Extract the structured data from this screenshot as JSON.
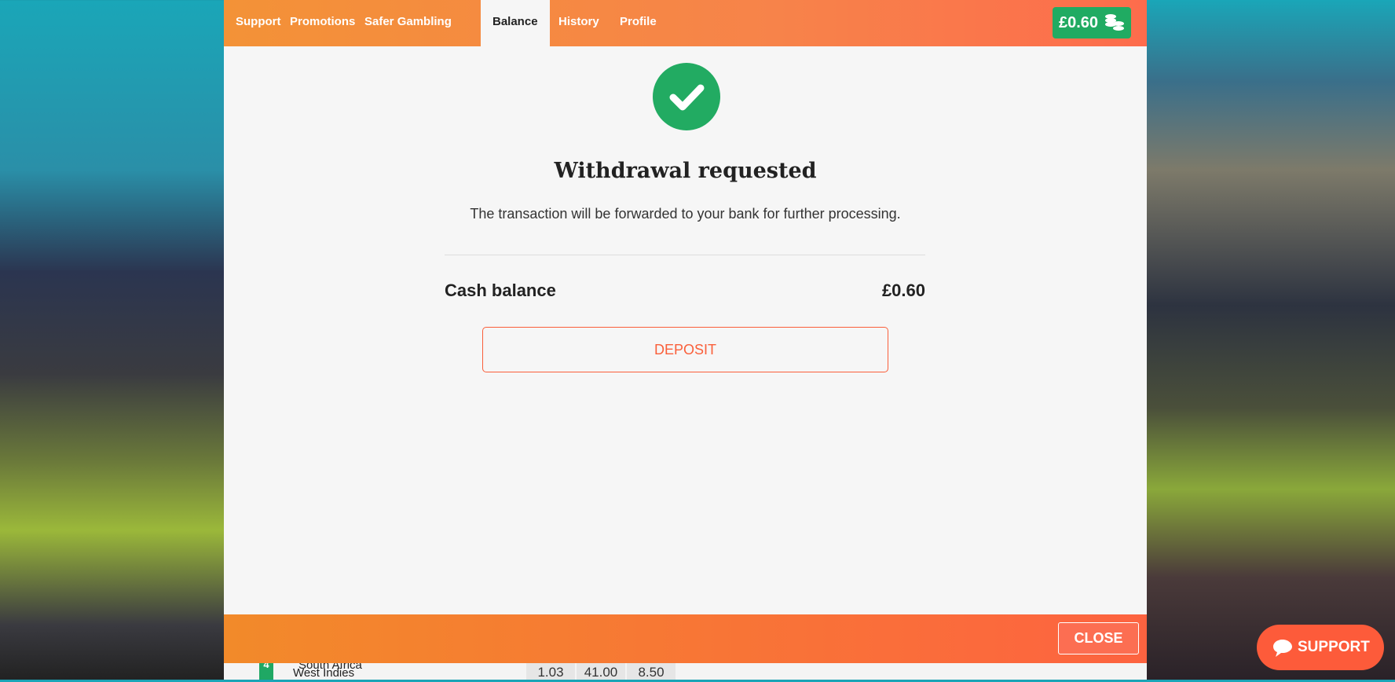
{
  "nav": {
    "tabs": [
      {
        "label": "Support"
      },
      {
        "label": "Promotions"
      },
      {
        "label": "Safer Gambling"
      },
      {
        "label": "Balance",
        "active": true
      },
      {
        "label": "History"
      },
      {
        "label": "Profile"
      }
    ],
    "balance": "£0.60",
    "balance_icon": "coins-icon"
  },
  "status": {
    "icon": "check-circle-icon",
    "color": "#22ab62",
    "title": "Withdrawal requested",
    "message": "The transaction will be forwarded to your bank for further processing."
  },
  "cash": {
    "label": "Cash balance",
    "value": "£0.60"
  },
  "deposit_label": "DEPOSIT",
  "close_label": "CLOSE",
  "support_label": "SUPPORT",
  "background": {
    "team_a": "South Africa",
    "team_b": "West Indies",
    "odds": [
      "1.03",
      "41.00",
      "8.50"
    ]
  },
  "colors": {
    "accent": "#fd5b3a",
    "success": "#22ab62"
  }
}
